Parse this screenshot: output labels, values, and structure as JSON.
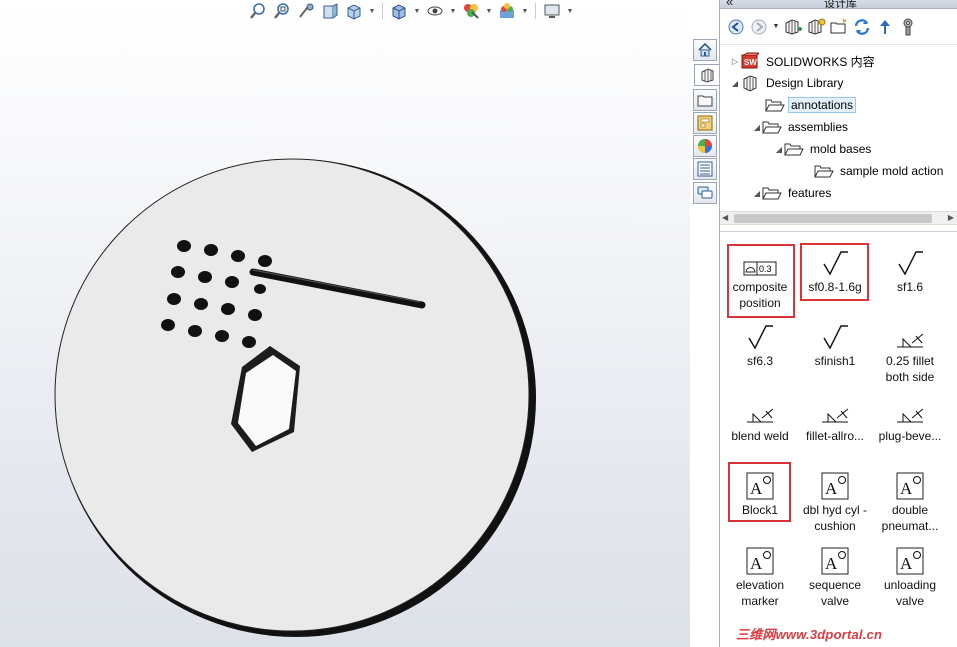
{
  "taskpane": {
    "title": "设计库",
    "collapse_glyph": "«",
    "toolbar": [
      "back-icon",
      "forward-icon",
      "add-to-library-icon",
      "add-file-location-icon",
      "create-new-folder-icon",
      "refresh-icon",
      "up-folder-icon",
      "options-icon"
    ]
  },
  "tree": {
    "items": [
      {
        "label": "SOLIDWORKS 内容",
        "icon": "solidworks-content-icon",
        "expander": "▷"
      },
      {
        "label": "Design Library",
        "icon": "design-library-icon",
        "expander": "◢"
      },
      {
        "label": "annotations",
        "icon": "folder-icon",
        "expander": "",
        "selected": true
      },
      {
        "label": "assemblies",
        "icon": "folder-icon",
        "expander": "◢"
      },
      {
        "label": "mold bases",
        "icon": "folder-icon",
        "expander": "◢"
      },
      {
        "label": "sample mold action",
        "icon": "folder-icon",
        "expander": ""
      },
      {
        "label": "features",
        "icon": "folder-icon",
        "expander": "◢"
      }
    ]
  },
  "palette": {
    "items": [
      {
        "label": "composite position",
        "icon": "composite-position-icon",
        "highlighted": true,
        "frame_text": "0.3"
      },
      {
        "label": "sf0.8-1.6g",
        "icon": "surface-finish-icon",
        "highlighted": true
      },
      {
        "label": "sf1.6",
        "icon": "surface-finish-icon",
        "highlighted": false
      },
      {
        "label": "sf6.3",
        "icon": "surface-finish-icon",
        "highlighted": false
      },
      {
        "label": "sfinish1",
        "icon": "surface-finish-icon",
        "highlighted": false
      },
      {
        "label": "0.25 fillet both side",
        "icon": "weld-symbol-icon",
        "highlighted": false
      },
      {
        "label": "blend weld",
        "icon": "weld-symbol-icon",
        "highlighted": false
      },
      {
        "label": "fillet-allro...",
        "icon": "weld-symbol-icon",
        "highlighted": false
      },
      {
        "label": "plug-beve...",
        "icon": "weld-symbol-icon",
        "highlighted": false
      },
      {
        "label": "Block1",
        "icon": "block-icon",
        "highlighted": true
      },
      {
        "label": "dbl hyd cyl - cushion",
        "icon": "block-icon",
        "highlighted": false
      },
      {
        "label": "double pneumat...",
        "icon": "block-icon",
        "highlighted": false
      },
      {
        "label": "elevation marker",
        "icon": "block-icon",
        "highlighted": false
      },
      {
        "label": "sequence valve",
        "icon": "block-icon",
        "highlighted": false
      },
      {
        "label": "unloading valve",
        "icon": "block-icon",
        "highlighted": false
      }
    ]
  },
  "side_tabs": [
    "home-icon",
    "design-library-icon",
    "file-explorer-icon",
    "view-palette-icon",
    "appearances-icon",
    "custom-properties-icon",
    "forum-icon"
  ],
  "view_toolbar": [
    "zoom-to-fit-icon",
    "zoom-to-area-icon",
    "previous-view-icon",
    "section-view-icon",
    "view-orientation-icon",
    "display-style-icon",
    "hide-show-icon",
    "edit-appearance-icon",
    "apply-scene-icon",
    "view-settings-icon"
  ],
  "watermark": "三维网www.3dportal.cn",
  "colors": {
    "highlight": "#d9343a",
    "part_face": "#eaeaea",
    "part_edge": "#1a1a1a",
    "watermark": "#e03a3e"
  }
}
